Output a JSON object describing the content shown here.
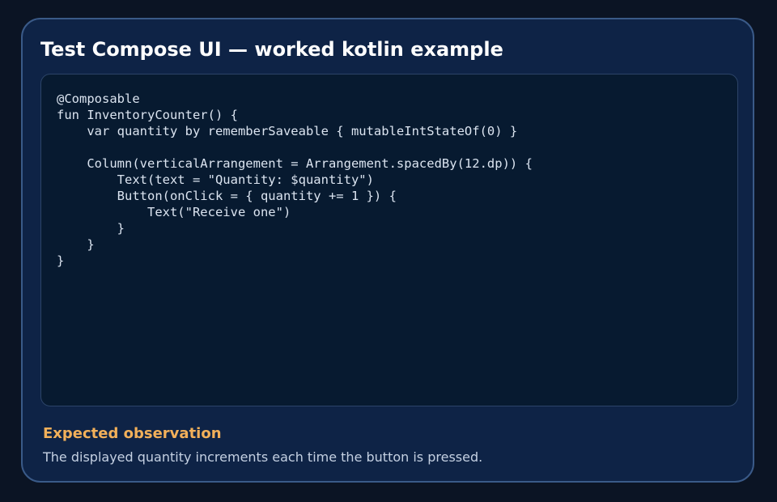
{
  "header": {
    "title": "Test Compose UI — worked kotlin example"
  },
  "code": {
    "language": "kotlin",
    "source": "@Composable\nfun InventoryCounter() {\n    var quantity by rememberSaveable { mutableIntStateOf(0) }\n\n    Column(verticalArrangement = Arrangement.spacedBy(12.dp)) {\n        Text(text = \"Quantity: $quantity\")\n        Button(onClick = { quantity += 1 }) {\n            Text(\"Receive one\")\n        }\n    }\n}"
  },
  "observation": {
    "heading": "Expected observation",
    "text": "The displayed quantity increments each time the button is pressed."
  },
  "colors": {
    "page_background": "#0b1424",
    "card_background": "#0e2346",
    "card_border": "#3a5a88",
    "code_background": "#071a30",
    "heading_accent": "#f2b05a"
  }
}
